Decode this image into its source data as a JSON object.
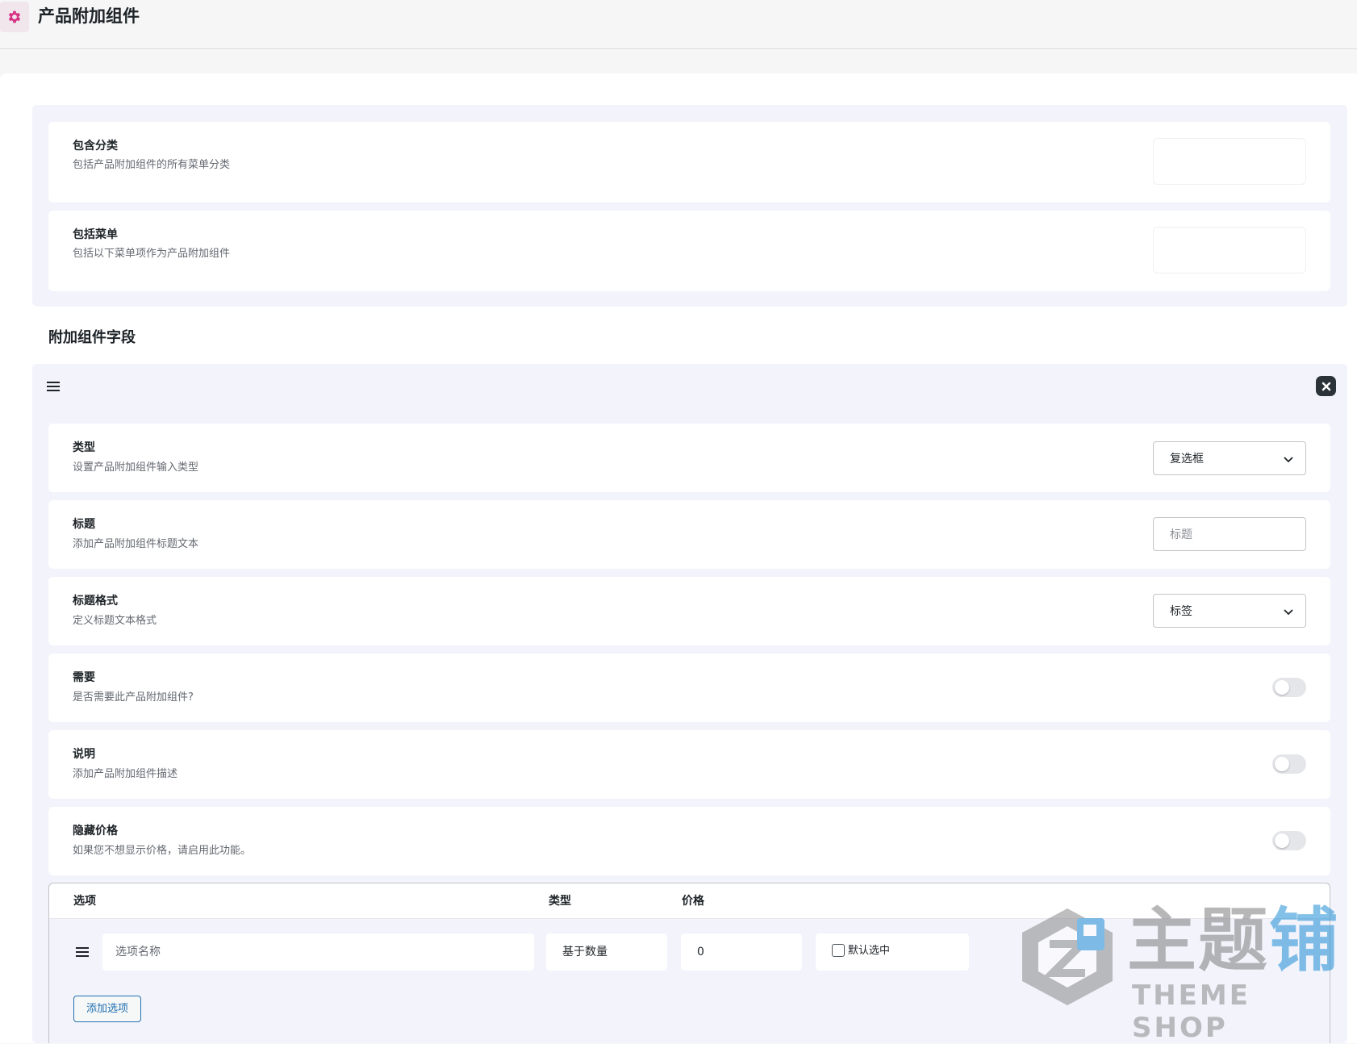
{
  "header": {
    "title": "产品附加组件",
    "icon": "gear-icon",
    "icon_color": "#d63384"
  },
  "settings": {
    "include_categories": {
      "label": "包含分类",
      "desc": "包括产品附加组件的所有菜单分类"
    },
    "include_menu": {
      "label": "包括菜单",
      "desc": "包括以下菜单项作为产品附加组件"
    }
  },
  "addon_fields": {
    "section_title": "附加组件字段",
    "type": {
      "label": "类型",
      "desc": "设置产品附加组件输入类型",
      "value": "复选框"
    },
    "title": {
      "label": "标题",
      "desc": "添加产品附加组件标题文本",
      "placeholder": "标题"
    },
    "title_format": {
      "label": "标题格式",
      "desc": "定义标题文本格式",
      "value": "标签"
    },
    "required": {
      "label": "需要",
      "desc": "是否需要此产品附加组件?",
      "enabled": false
    },
    "description": {
      "label": "说明",
      "desc": "添加产品附加组件描述",
      "enabled": false
    },
    "hide_price": {
      "label": "隐藏价格",
      "desc": "如果您不想显示价格，请启用此功能。",
      "enabled": false
    }
  },
  "options_table": {
    "columns": {
      "option": "选项",
      "type": "类型",
      "price": "价格"
    },
    "rows": [
      {
        "name_placeholder": "选项名称",
        "type": "基于数量",
        "price": "0",
        "default_label": "默认选中",
        "default_checked": false
      }
    ],
    "add_button": "添加选项"
  },
  "watermark": {
    "cn_gray": "主题",
    "cn_blue": "铺",
    "en": "THEME SHOP"
  }
}
